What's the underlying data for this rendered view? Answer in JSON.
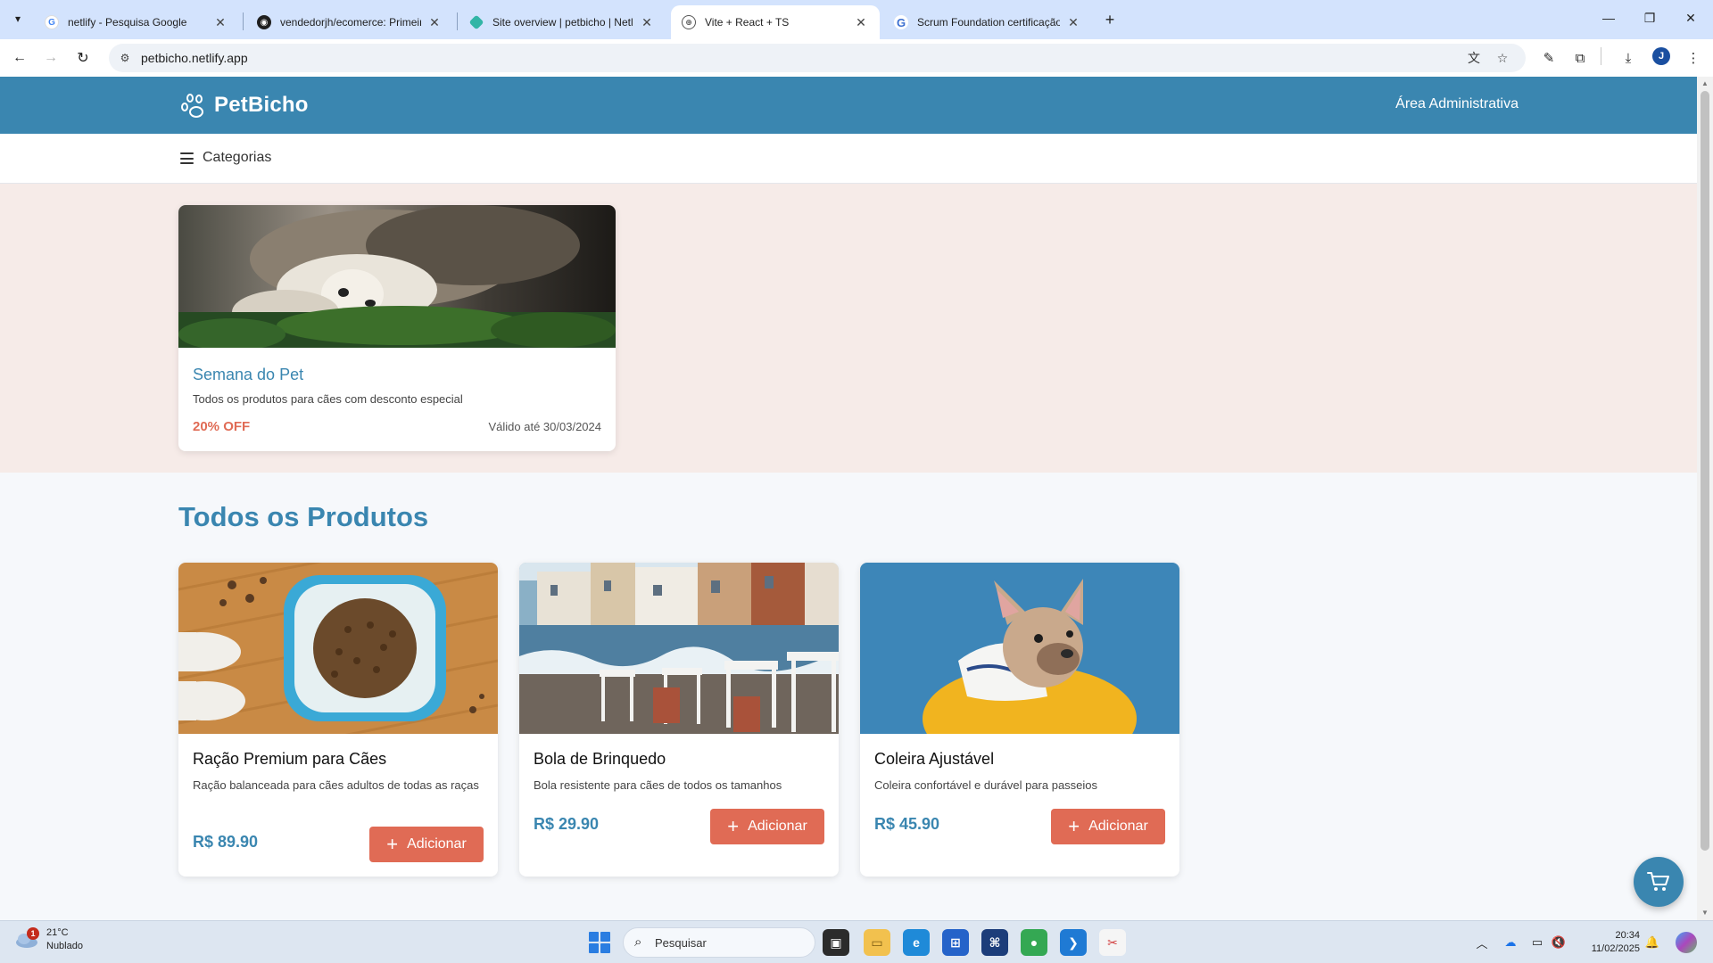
{
  "browser": {
    "tabs": [
      {
        "title": "netlify - Pesquisa Google",
        "icon": "google-icon"
      },
      {
        "title": "vendedorjh/ecomerce: Primeiro",
        "icon": "github-icon"
      },
      {
        "title": "Site overview | petbicho | Netlify",
        "icon": "netlify-icon"
      },
      {
        "title": "Vite + React + TS",
        "icon": "globe-icon"
      },
      {
        "title": "Scrum Foundation certificação",
        "icon": "scrum-icon"
      }
    ],
    "active_tab_index": 3,
    "url": "petbicho.netlify.app",
    "profile_initial": "J"
  },
  "site": {
    "brand": "PetBicho",
    "admin_link": "Área Administrativa",
    "categories_label": "Categorias",
    "promo": {
      "title": "Semana do Pet",
      "description": "Todos os produtos para cães com desconto especial",
      "discount": "20% OFF",
      "valid_until": "Válido até 30/03/2024"
    },
    "section_title": "Todos os Produtos",
    "products": [
      {
        "name": "Ração Premium para Cães",
        "description": "Ração balanceada para cães adultos de todas as raças",
        "price": "R$ 89.90",
        "button": "Adicionar"
      },
      {
        "name": "Bola de Brinquedo",
        "description": "Bola resistente para cães de todos os tamanhos",
        "price": "R$ 29.90",
        "button": "Adicionar"
      },
      {
        "name": "Coleira Ajustável",
        "description": "Coleira confortável e durável para passeios",
        "price": "R$ 45.90",
        "button": "Adicionar"
      }
    ]
  },
  "colors": {
    "primary": "#3a86b0",
    "accent": "#e06b55",
    "promo_background": "#f6ebe8",
    "page_background": "#f6f8fb"
  },
  "taskbar": {
    "weather_temp": "21°C",
    "weather_desc": "Nublado",
    "weather_badge": "1",
    "search_placeholder": "Pesquisar",
    "time": "20:34",
    "date": "11/02/2025"
  }
}
